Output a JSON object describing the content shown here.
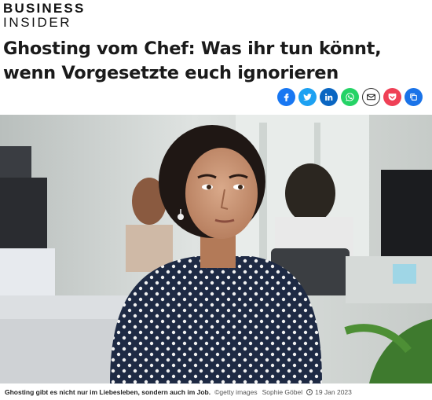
{
  "brand": {
    "line1": "BUSINESS",
    "line2": "INSIDER"
  },
  "article": {
    "headline": "Ghosting vom Chef: Was ihr tun könnt, wenn Vorgesetzte euch ignorieren"
  },
  "share": [
    {
      "icon": "facebook-icon",
      "glyph": "f",
      "color": "#1877f2"
    },
    {
      "icon": "twitter-icon",
      "glyph": "t",
      "color": "#1da1f2"
    },
    {
      "icon": "linkedin-icon",
      "glyph": "in",
      "color": "#0a66c2"
    },
    {
      "icon": "whatsapp-icon",
      "glyph": "w",
      "color": "#25d366"
    },
    {
      "icon": "email-icon",
      "glyph": "✉",
      "color": "#ffffff"
    },
    {
      "icon": "pocket-icon",
      "glyph": "p",
      "color": "#ef4056"
    },
    {
      "icon": "copy-link-icon",
      "glyph": "⧉",
      "color": "#1a73e8"
    }
  ],
  "image": {
    "caption": "Ghosting gibt es nicht nur im Liebesleben, sondern auch im Job.",
    "credit": "©getty images",
    "author": "Sophie Göbel",
    "date": "19 Jan 2023"
  }
}
